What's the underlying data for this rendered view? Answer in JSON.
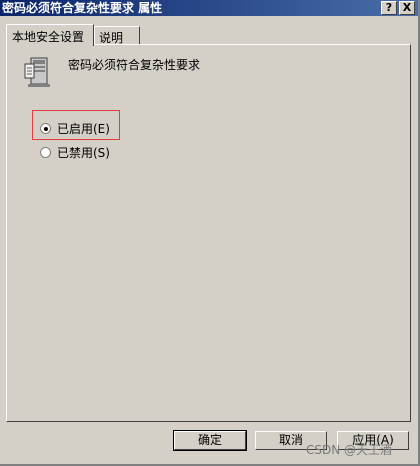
{
  "window": {
    "title": "密码必须符合复杂性要求 属性",
    "help_label": "?",
    "close_label": "X"
  },
  "tabs": [
    {
      "label": "本地安全设置",
      "active": true
    },
    {
      "label": "说明",
      "active": false
    }
  ],
  "policy": {
    "name": "密码必须符合复杂性要求",
    "icon": "server-policy-icon"
  },
  "options": [
    {
      "label": "已启用(E)",
      "checked": true
    },
    {
      "label": "已禁用(S)",
      "checked": false
    }
  ],
  "buttons": {
    "ok": "确定",
    "cancel": "取消",
    "apply": "应用(A)"
  },
  "watermark": "CSDN @天王酒"
}
